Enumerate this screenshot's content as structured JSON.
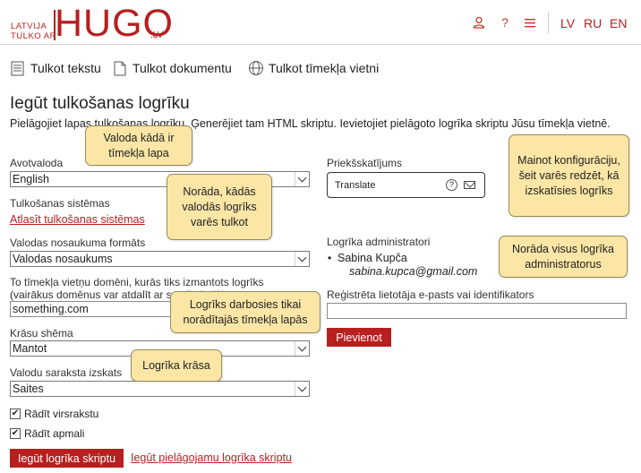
{
  "header": {
    "logo_small_line1": "LATVIJA",
    "logo_small_line2": "TULKO AR",
    "logo_big": "HUGO",
    "logo_suffix": ".LV",
    "icons": [
      "user-icon",
      "help-icon",
      "menu-icon"
    ],
    "languages": [
      "LV",
      "RU",
      "EN"
    ]
  },
  "tabs": [
    {
      "label": "Tulkot tekstu",
      "icon": "document-icon"
    },
    {
      "label": "Tulkot dokumentu",
      "icon": "file-icon"
    },
    {
      "label": "Tulkot tīmekļa vietni",
      "icon": "globe-icon"
    }
  ],
  "page": {
    "title": "Iegūt tulkošanas logrīku",
    "intro": "Pielāgojiet lapas tulkošanas logrīku. Ģenerējiet tam HTML skriptu. Ievietojiet pielāgoto logrīka skriptu Jūsu tīmekļa vietnē."
  },
  "form": {
    "source_lang_label": "Avotvaloda",
    "source_lang_value": "English",
    "system_label": "Tulkošanas sistēmas",
    "system_link": "Atlasīt tulkošanas sistēmas",
    "name_format_label": "Valodas nosaukuma formāts",
    "name_format_value": "Valodas nosaukums",
    "domains_label": "To tīmekļa vietņu domēni, kurās tiks izmantots logrīks (vairākus domēnus var atdalīt ar semikolu (;))",
    "domains_value": "something.com",
    "color_label": "Krāsu shēma",
    "color_value": "Mantot",
    "list_label": "Valodu saraksta izskats",
    "list_value": "Saites",
    "show_title_label": "Rādīt virsrakstu",
    "show_border_label": "Rādīt apmali",
    "get_script_button": "Iegūt logrīka skriptu",
    "get_custom_link": "Iegūt pielāgojamu logrīka skriptu"
  },
  "preview": {
    "label": "Priekšskatījums",
    "widget_text": "Translate"
  },
  "admins": {
    "label": "Logrīka administratori",
    "name": "Sabina Kupča",
    "email": "sabina.kupca@gmail.com",
    "register_label": "Reģistrēta lietotāja e-pasts vai identifikators",
    "register_value": "",
    "add_button": "Pievienot"
  },
  "callouts": {
    "source": "Valoda kādā ir tīmekļa lapa",
    "system": "Norāda, kādās valodās logrīks varēs tulkot",
    "preview": "Mainot konfigurāciju, šeit varēs redzēt, kā izskatīsies logrīks",
    "admins": "Norāda visus logrīka administratorus",
    "domains": "Logrīks darbosies tikai norādītajās tīmekļa lapās",
    "color": "Logrīka krāsa"
  },
  "colors": {
    "accent": "#b81f1f",
    "callout_bg": "#fbe6a6"
  }
}
